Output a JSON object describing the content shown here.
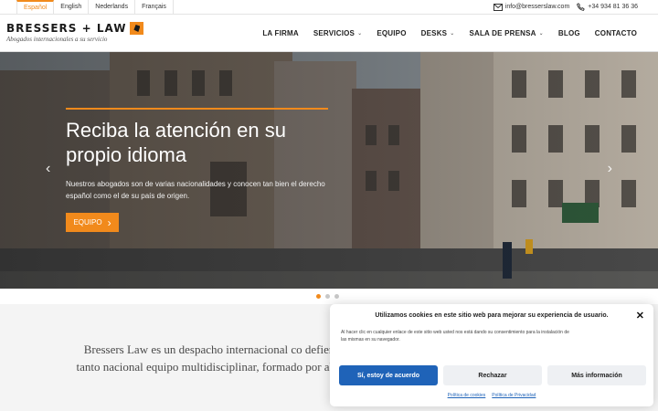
{
  "topbar": {
    "languages": [
      {
        "label": "Español",
        "active": true
      },
      {
        "label": "English",
        "active": false
      },
      {
        "label": "Nederlands",
        "active": false
      },
      {
        "label": "Français",
        "active": false
      }
    ],
    "email": "info@bresserslaw.com",
    "phone": "+34 934 81 36 36",
    "email_icon": "envelope-icon",
    "phone_icon": "phone-icon"
  },
  "header": {
    "logo_text": "BRESSERS + LAW",
    "tagline": "Abogados internacionales a su servicio",
    "nav": [
      {
        "label": "LA FIRMA",
        "dropdown": false
      },
      {
        "label": "SERVICIOS",
        "dropdown": true
      },
      {
        "label": "EQUIPO",
        "dropdown": false
      },
      {
        "label": "DESKS",
        "dropdown": true
      },
      {
        "label": "SALA DE PRENSA",
        "dropdown": true
      },
      {
        "label": "BLOG",
        "dropdown": false
      },
      {
        "label": "CONTACTO",
        "dropdown": false
      }
    ]
  },
  "hero": {
    "title": "Reciba la atención en su propio idioma",
    "text": "Nuestros abogados son de varias nacionalidades y conocen tan bien el derecho español como el de su país de origen.",
    "button_label": "EQUIPO",
    "prev_label": "‹",
    "next_label": "›",
    "slides_total": 3,
    "slide_active": 1
  },
  "intro": {
    "text": "Bressers Law es un despacho internacional co defiende los intereses de clientes tanto nacional equipo multidisciplinar, formado por abogados y reconocida trayect"
  },
  "cookie": {
    "title": "Utilizamos cookies en este sitio web para mejorar su experiencia de usuario.",
    "body": "Al hacer clic en cualquier enlace de este sitio web usted nos está dando su consentimiento para la instalación de las mismas en su navegador.",
    "accept_label": "Sí, estoy de acuerdo",
    "reject_label": "Rechazar",
    "more_label": "Más información",
    "close_label": "✕",
    "policy_link": "Política de cookies",
    "privacy_link": "Política de Privacidad"
  },
  "colors": {
    "accent": "#f18a1c",
    "button_blue": "#1f63b8"
  }
}
